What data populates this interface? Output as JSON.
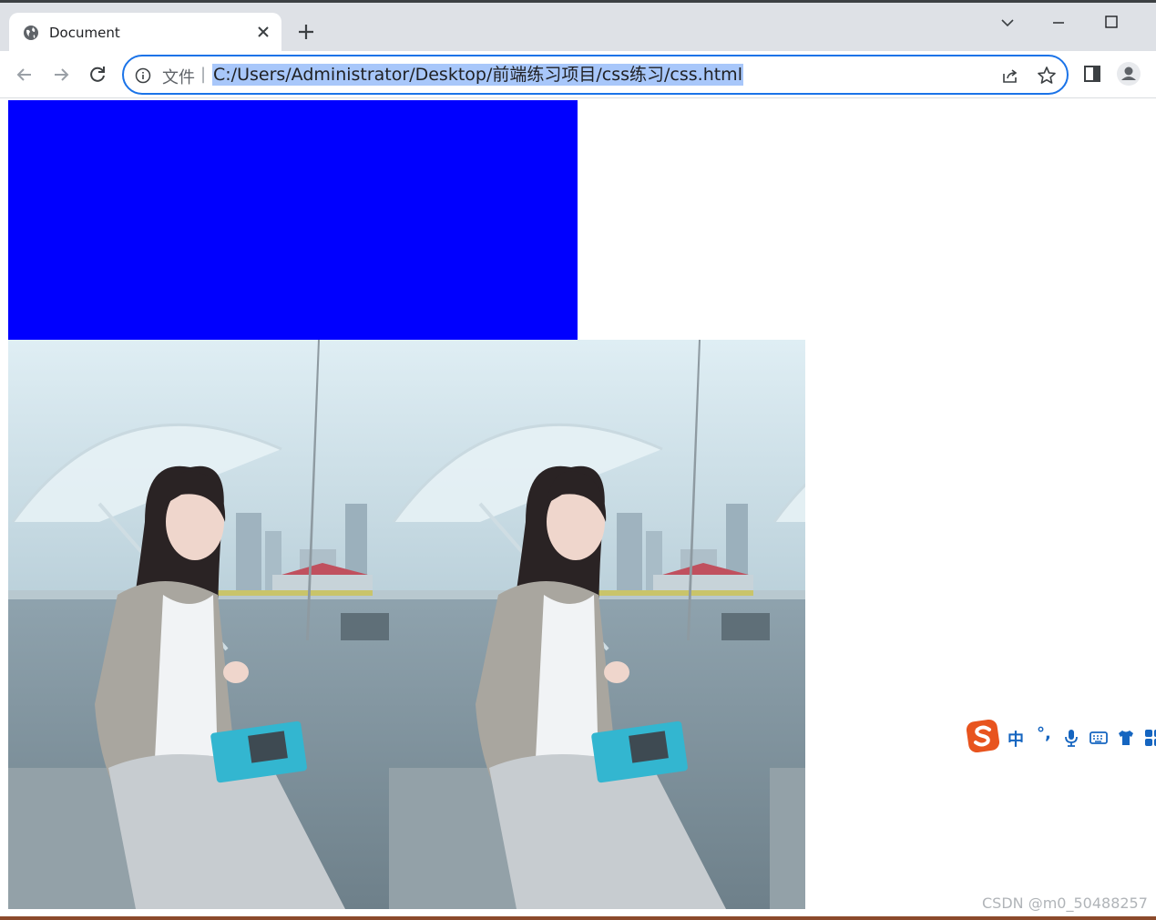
{
  "browser": {
    "tab": {
      "title": "Document",
      "icon": "globe-icon",
      "close_icon": "close-icon"
    },
    "new_tab_icon": "plus-icon",
    "window_controls": [
      "tab-search-icon",
      "minimize-icon",
      "maximize-icon"
    ],
    "nav": [
      "back-icon",
      "forward-icon",
      "reload-icon"
    ],
    "address_bar": {
      "scheme_label": "文件",
      "separator": "|",
      "url": "C:/Users/Administrator/Desktop/前端练习项目/css练习/css.html",
      "url_selected": true,
      "icons": [
        "info-icon",
        "share-icon",
        "bookmark-star-icon"
      ]
    },
    "toolbar_icons": [
      "side-panel-icon",
      "profile-avatar-icon"
    ]
  },
  "page": {
    "blue_box_color": "#0000ff",
    "photo_tiles": 3,
    "photo_description_icon": "repeated-background-photo"
  },
  "ime_toolbar": {
    "logo": "sogou-s-icon",
    "mode_label": "中",
    "punct_label": "°,",
    "icons": [
      "microphone-icon",
      "keyboard-icon",
      "skin-shirt-icon",
      "apps-grid-icon"
    ]
  },
  "watermark": "CSDN @m0_50488257",
  "colors": {
    "accent": "#1a73e8",
    "selection": "#a8c7fa",
    "ime": "#1565c0",
    "sogou": "#e8541e"
  }
}
